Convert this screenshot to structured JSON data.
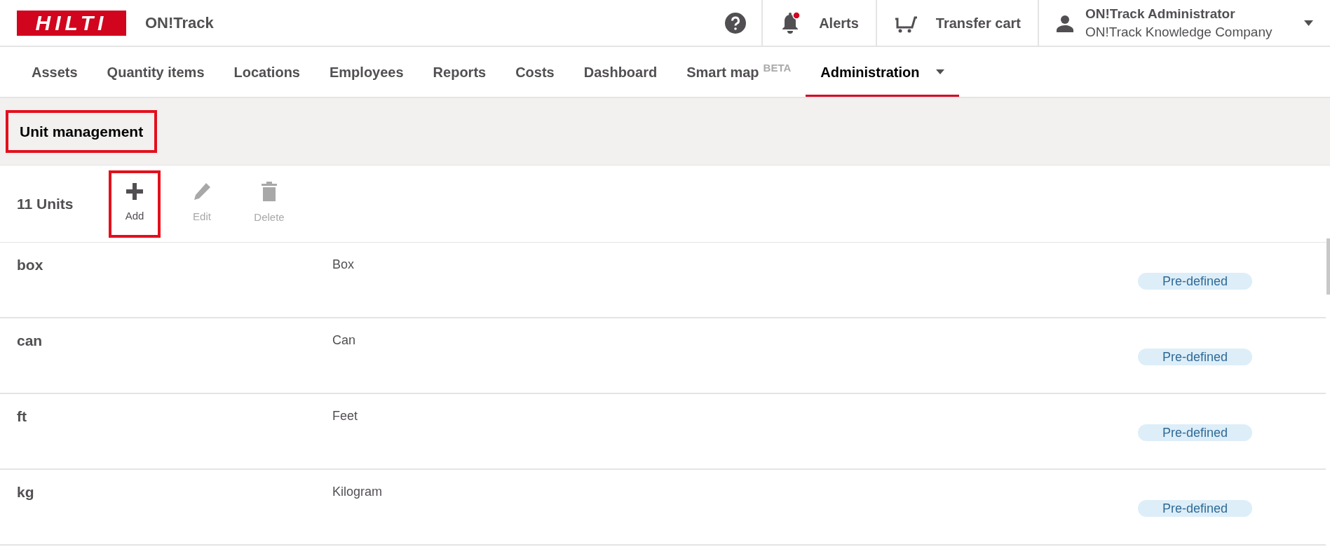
{
  "header": {
    "logo": "HILTI",
    "app_name": "ON!Track",
    "alerts": {
      "label": "Alerts",
      "unread": true
    },
    "transfer_cart": "Transfer cart",
    "user": {
      "name": "ON!Track Administrator",
      "company": "ON!Track Knowledge Company"
    }
  },
  "nav": [
    {
      "label": "Assets",
      "selected": false
    },
    {
      "label": "Quantity items",
      "selected": false
    },
    {
      "label": "Locations",
      "selected": false
    },
    {
      "label": "Employees",
      "selected": false
    },
    {
      "label": "Reports",
      "selected": false
    },
    {
      "label": "Costs",
      "selected": false
    },
    {
      "label": "Dashboard",
      "selected": false
    },
    {
      "label": "Smart map",
      "badge": "BETA",
      "selected": false
    },
    {
      "label": "Administration",
      "dropdown": true,
      "selected": true
    }
  ],
  "page_title": {
    "text": "Unit management",
    "highlighted": true
  },
  "toolbar": {
    "count": "11 Units",
    "actions": [
      {
        "kind": "add",
        "label": "Add",
        "disabled": false,
        "highlighted": true
      },
      {
        "kind": "edit",
        "label": "Edit",
        "disabled": true,
        "highlighted": false
      },
      {
        "kind": "delete",
        "label": "Delete",
        "disabled": true,
        "highlighted": false
      }
    ]
  },
  "units": [
    {
      "code": "box",
      "name": "Box",
      "tag": "Pre-defined"
    },
    {
      "code": "can",
      "name": "Can",
      "tag": "Pre-defined"
    },
    {
      "code": "ft",
      "name": "Feet",
      "tag": "Pre-defined"
    },
    {
      "code": "kg",
      "name": "Kilogram",
      "tag": "Pre-defined"
    }
  ]
}
